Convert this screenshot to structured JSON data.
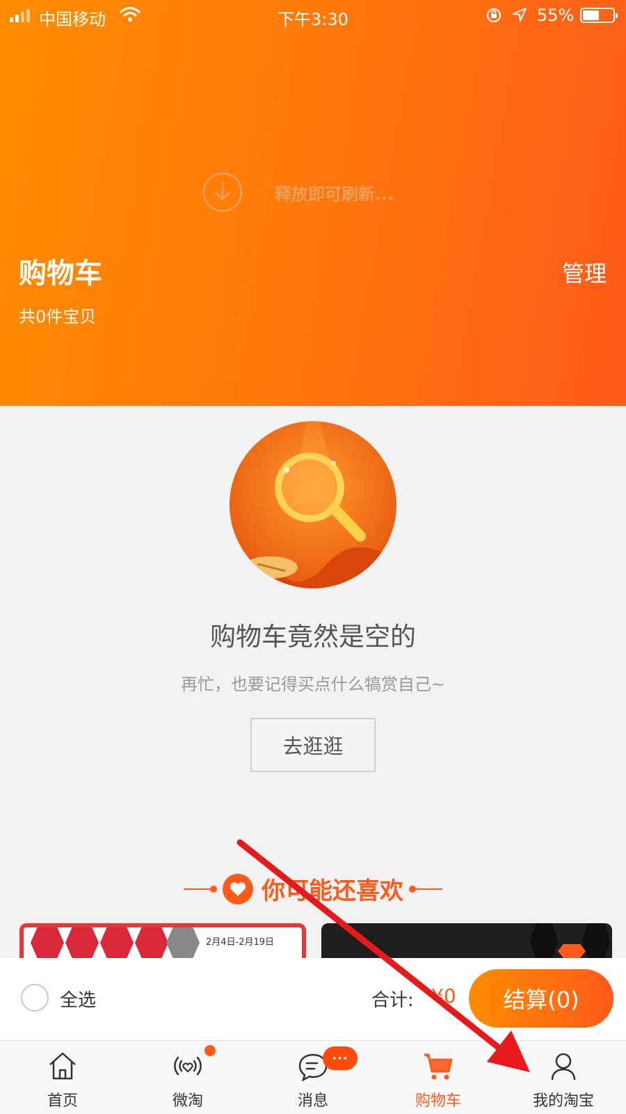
{
  "status_bar": {
    "carrier": "中国移动",
    "time": "下午3:30",
    "battery_percent": "55%",
    "battery_level": 0.55,
    "icons": [
      "signal-icon",
      "wifi-icon",
      "rotation-lock-icon",
      "location-icon",
      "battery-icon"
    ]
  },
  "header": {
    "refresh_text": "释放即可刷新...",
    "title": "购物车",
    "item_count": "共0件宝贝",
    "manage_label": "管理"
  },
  "empty_state": {
    "title": "购物车竟然是空的",
    "subtitle": "再忙，也要记得买点什么犒赏自己~",
    "button_label": "去逛逛"
  },
  "recommendations": {
    "heading": "你可能还喜欢",
    "card_left_tag": "2月4日-2月19日"
  },
  "checkout": {
    "select_all_label": "全选",
    "total_label": "合计:",
    "total_value": "¥0",
    "checkout_label": "结算(0)"
  },
  "tabbar": {
    "tabs": [
      {
        "label": "首页",
        "icon": "home-icon"
      },
      {
        "label": "微淘",
        "icon": "weitao-icon"
      },
      {
        "label": "消息",
        "icon": "message-icon",
        "badge": "···"
      },
      {
        "label": "购物车",
        "icon": "cart-icon",
        "active": true
      },
      {
        "label": "我的淘宝",
        "icon": "profile-icon"
      }
    ]
  },
  "colors": {
    "brand_orange": "#ff8c00",
    "brand_red_orange": "#ff5a1a",
    "annotation_red": "#e8191c"
  }
}
